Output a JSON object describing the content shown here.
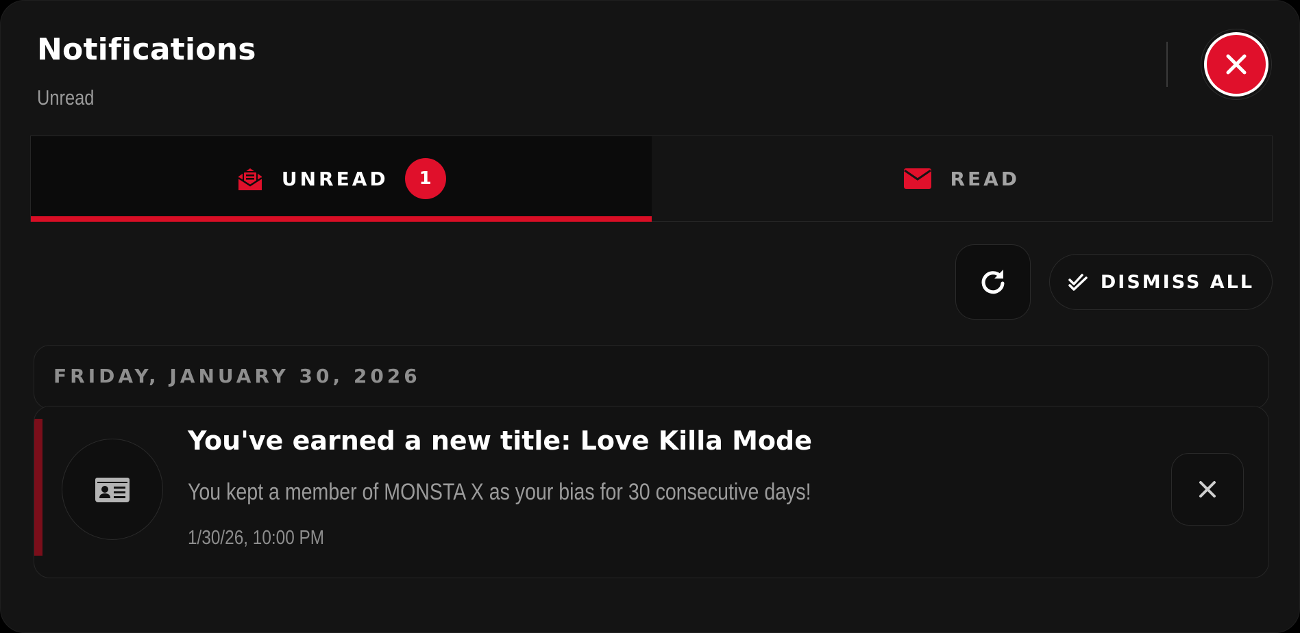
{
  "header": {
    "title": "Notifications",
    "subtitle": "Unread",
    "close_icon": "close-icon"
  },
  "tabs": [
    {
      "label": "UNREAD",
      "icon": "envelope-open-icon",
      "badge": "1",
      "active": true
    },
    {
      "label": "READ",
      "icon": "envelope-icon",
      "active": false
    }
  ],
  "toolbar": {
    "refresh_icon": "refresh-icon",
    "dismiss_all_label": "DISMISS ALL",
    "dismiss_all_icon": "double-check-icon"
  },
  "groups": [
    {
      "date": "FRIDAY, JANUARY 30, 2026",
      "notifications": [
        {
          "icon": "id-card-icon",
          "title": "You've earned a new title: Love Killa Mode",
          "body": "You kept a member of MONSTA X as your bias for 30 consecutive days!",
          "time": "1/30/26, 10:00 PM",
          "dismiss_icon": "close-icon"
        }
      ]
    }
  ],
  "colors": {
    "accent": "#e0102b",
    "background": "#141414",
    "muted_text": "#9b9b9b"
  }
}
